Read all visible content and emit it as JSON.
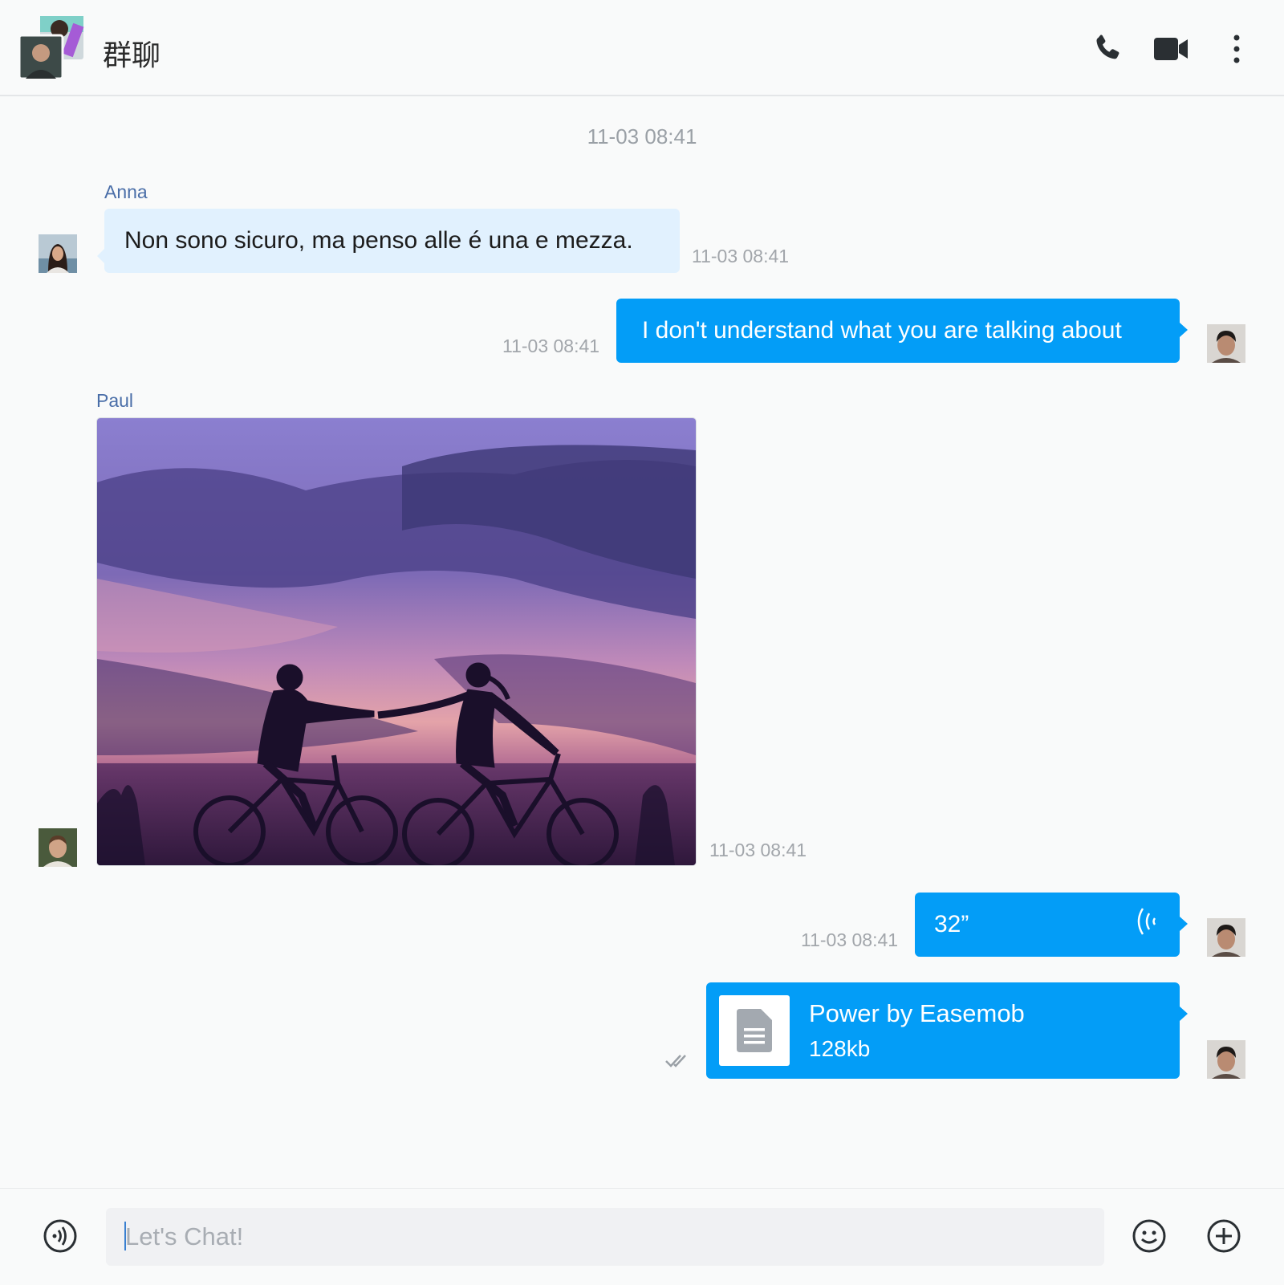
{
  "header": {
    "title": "群聊",
    "call_icon": "phone-icon",
    "video_icon": "video-camera-icon",
    "menu_icon": "more-vertical-icon"
  },
  "messages": {
    "top_time": "11-03 08:41",
    "m1": {
      "sender": "Anna",
      "text": "Non sono sicuro, ma penso alle é una e mezza.",
      "time": "11-03 08:41"
    },
    "m2": {
      "text": "I don't understand what you are talking about",
      "time": "11-03 08:41"
    },
    "m3": {
      "sender": "Paul",
      "time": "11-03 08:41"
    },
    "m4": {
      "duration": "32”",
      "time": "11-03 08:41"
    },
    "m5": {
      "file_name": "Power by Easemob",
      "file_size": "128kb",
      "status_icon": "double-check-icon"
    }
  },
  "composer": {
    "placeholder": "Let's Chat!",
    "voice_icon": "voice-icon",
    "emoji_icon": "emoji-icon",
    "add_icon": "plus-circle-icon"
  },
  "colors": {
    "accent": "#039df7",
    "received_bubble": "#e1f1fe",
    "sender_name": "#4a6ea8",
    "timestamp": "#a2a6ab",
    "background": "#f9fafa"
  }
}
